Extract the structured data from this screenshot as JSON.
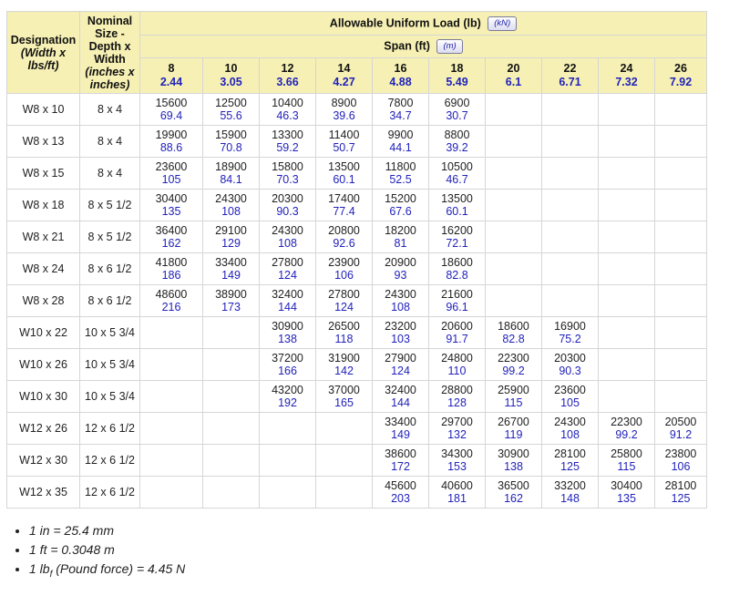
{
  "header": {
    "designation_line1": "Designation",
    "designation_line2": "(Width x lbs/ft)",
    "nominal_line1": "Nominal Size - Depth x Width",
    "nominal_line2": "(inches x inches)",
    "load_title": "Allowable Uniform Load (lb)",
    "load_unit_button": "(kN)",
    "span_title": "Span (ft)",
    "span_unit_button": "(m)"
  },
  "spans": [
    {
      "ft": "8",
      "m": "2.44"
    },
    {
      "ft": "10",
      "m": "3.05"
    },
    {
      "ft": "12",
      "m": "3.66"
    },
    {
      "ft": "14",
      "m": "4.27"
    },
    {
      "ft": "16",
      "m": "4.88"
    },
    {
      "ft": "18",
      "m": "5.49"
    },
    {
      "ft": "20",
      "m": "6.1"
    },
    {
      "ft": "22",
      "m": "6.71"
    },
    {
      "ft": "24",
      "m": "7.32"
    },
    {
      "ft": "26",
      "m": "7.92"
    }
  ],
  "rows": [
    {
      "designation": "W8 x 10",
      "nominal": "8 x 4",
      "cells": [
        [
          "15600",
          "69.4"
        ],
        [
          "12500",
          "55.6"
        ],
        [
          "10400",
          "46.3"
        ],
        [
          "8900",
          "39.6"
        ],
        [
          "7800",
          "34.7"
        ],
        [
          "6900",
          "30.7"
        ],
        null,
        null,
        null,
        null
      ]
    },
    {
      "designation": "W8 x 13",
      "nominal": "8 x 4",
      "cells": [
        [
          "19900",
          "88.6"
        ],
        [
          "15900",
          "70.8"
        ],
        [
          "13300",
          "59.2"
        ],
        [
          "11400",
          "50.7"
        ],
        [
          "9900",
          "44.1"
        ],
        [
          "8800",
          "39.2"
        ],
        null,
        null,
        null,
        null
      ]
    },
    {
      "designation": "W8 x 15",
      "nominal": "8 x 4",
      "cells": [
        [
          "23600",
          "105"
        ],
        [
          "18900",
          "84.1"
        ],
        [
          "15800",
          "70.3"
        ],
        [
          "13500",
          "60.1"
        ],
        [
          "11800",
          "52.5"
        ],
        [
          "10500",
          "46.7"
        ],
        null,
        null,
        null,
        null
      ]
    },
    {
      "designation": "W8 x 18",
      "nominal": "8 x 5 1/2",
      "cells": [
        [
          "30400",
          "135"
        ],
        [
          "24300",
          "108"
        ],
        [
          "20300",
          "90.3"
        ],
        [
          "17400",
          "77.4"
        ],
        [
          "15200",
          "67.6"
        ],
        [
          "13500",
          "60.1"
        ],
        null,
        null,
        null,
        null
      ]
    },
    {
      "designation": "W8 x 21",
      "nominal": "8 x 5 1/2",
      "cells": [
        [
          "36400",
          "162"
        ],
        [
          "29100",
          "129"
        ],
        [
          "24300",
          "108"
        ],
        [
          "20800",
          "92.6"
        ],
        [
          "18200",
          "81"
        ],
        [
          "16200",
          "72.1"
        ],
        null,
        null,
        null,
        null
      ]
    },
    {
      "designation": "W8 x 24",
      "nominal": "8 x 6 1/2",
      "cells": [
        [
          "41800",
          "186"
        ],
        [
          "33400",
          "149"
        ],
        [
          "27800",
          "124"
        ],
        [
          "23900",
          "106"
        ],
        [
          "20900",
          "93"
        ],
        [
          "18600",
          "82.8"
        ],
        null,
        null,
        null,
        null
      ]
    },
    {
      "designation": "W8 x 28",
      "nominal": "8 x 6 1/2",
      "cells": [
        [
          "48600",
          "216"
        ],
        [
          "38900",
          "173"
        ],
        [
          "32400",
          "144"
        ],
        [
          "27800",
          "124"
        ],
        [
          "24300",
          "108"
        ],
        [
          "21600",
          "96.1"
        ],
        null,
        null,
        null,
        null
      ]
    },
    {
      "designation": "W10 x 22",
      "nominal": "10 x 5 3/4",
      "cells": [
        null,
        null,
        [
          "30900",
          "138"
        ],
        [
          "26500",
          "118"
        ],
        [
          "23200",
          "103"
        ],
        [
          "20600",
          "91.7"
        ],
        [
          "18600",
          "82.8"
        ],
        [
          "16900",
          "75.2"
        ],
        null,
        null
      ]
    },
    {
      "designation": "W10 x 26",
      "nominal": "10 x 5 3/4",
      "cells": [
        null,
        null,
        [
          "37200",
          "166"
        ],
        [
          "31900",
          "142"
        ],
        [
          "27900",
          "124"
        ],
        [
          "24800",
          "110"
        ],
        [
          "22300",
          "99.2"
        ],
        [
          "20300",
          "90.3"
        ],
        null,
        null
      ]
    },
    {
      "designation": "W10 x 30",
      "nominal": "10 x 5 3/4",
      "cells": [
        null,
        null,
        [
          "43200",
          "192"
        ],
        [
          "37000",
          "165"
        ],
        [
          "32400",
          "144"
        ],
        [
          "28800",
          "128"
        ],
        [
          "25900",
          "115"
        ],
        [
          "23600",
          "105"
        ],
        null,
        null
      ]
    },
    {
      "designation": "W12 x 26",
      "nominal": "12 x 6 1/2",
      "cells": [
        null,
        null,
        null,
        null,
        [
          "33400",
          "149"
        ],
        [
          "29700",
          "132"
        ],
        [
          "26700",
          "119"
        ],
        [
          "24300",
          "108"
        ],
        [
          "22300",
          "99.2"
        ],
        [
          "20500",
          "91.2"
        ]
      ]
    },
    {
      "designation": "W12 x 30",
      "nominal": "12 x 6 1/2",
      "cells": [
        null,
        null,
        null,
        null,
        [
          "38600",
          "172"
        ],
        [
          "34300",
          "153"
        ],
        [
          "30900",
          "138"
        ],
        [
          "28100",
          "125"
        ],
        [
          "25800",
          "115"
        ],
        [
          "23800",
          "106"
        ]
      ]
    },
    {
      "designation": "W12 x 35",
      "nominal": "12 x 6 1/2",
      "cells": [
        null,
        null,
        null,
        null,
        [
          "45600",
          "203"
        ],
        [
          "40600",
          "181"
        ],
        [
          "36500",
          "162"
        ],
        [
          "33200",
          "148"
        ],
        [
          "30400",
          "135"
        ],
        [
          "28100",
          "125"
        ]
      ]
    }
  ],
  "notes": {
    "n1": "1 in = 25.4 mm",
    "n2": "1 ft = 0.3048 m",
    "n3_pre": "1 lb",
    "n3_sub": "f",
    "n3_post": " (Pound force) = 4.45 N"
  }
}
